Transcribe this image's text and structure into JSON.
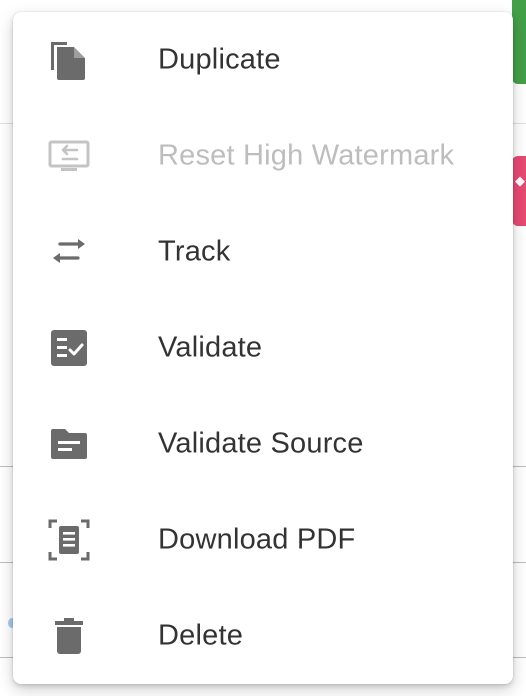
{
  "menu": {
    "items": [
      {
        "label": "Duplicate",
        "icon": "duplicate-icon",
        "enabled": true
      },
      {
        "label": "Reset High Watermark",
        "icon": "reset-watermark-icon",
        "enabled": false
      },
      {
        "label": "Track",
        "icon": "track-arrows-icon",
        "enabled": true
      },
      {
        "label": "Validate",
        "icon": "validate-checklist-icon",
        "enabled": true
      },
      {
        "label": "Validate Source",
        "icon": "folder-icon",
        "enabled": true
      },
      {
        "label": "Download PDF",
        "icon": "document-frame-icon",
        "enabled": true
      },
      {
        "label": "Delete",
        "icon": "trash-icon",
        "enabled": true
      }
    ]
  },
  "colors": {
    "icon": "#6b6b6b",
    "icon_disabled": "#c4c4c4",
    "text": "#333333",
    "text_disabled": "#bdbdbd"
  }
}
